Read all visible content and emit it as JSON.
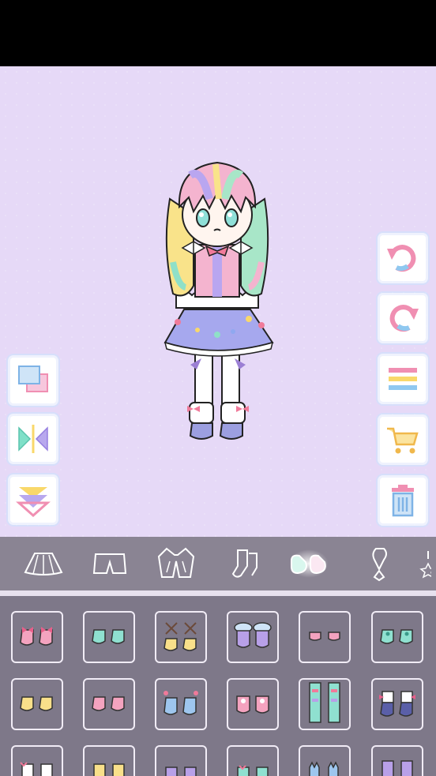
{
  "app": {
    "screen": "dress-up"
  },
  "colors": {
    "canvas_bg": "#e6d9f7",
    "tab_bar": "#8a8493",
    "grid_bg": "#7e7889",
    "item_border": "#f1ecf6"
  },
  "left_tools": [
    {
      "icon": "layers-icon"
    },
    {
      "icon": "flip-icon"
    },
    {
      "icon": "move-down-icon"
    }
  ],
  "right_tools": [
    {
      "icon": "undo-icon"
    },
    {
      "icon": "redo-icon"
    },
    {
      "icon": "menu-icon"
    },
    {
      "icon": "cart-icon"
    },
    {
      "icon": "trash-icon"
    }
  ],
  "tabs": [
    {
      "icon": "skirt-icon",
      "active": false
    },
    {
      "icon": "shorts-icon",
      "active": false
    },
    {
      "icon": "jacket-icon",
      "active": false
    },
    {
      "icon": "socks-icon",
      "active": false
    },
    {
      "icon": "shoes-icon",
      "active": true
    },
    {
      "icon": "accessory-icon",
      "active": false
    },
    {
      "icon": "more-icon",
      "active": false
    }
  ],
  "items": [
    {
      "icon": "pink-bow-shoes-icon"
    },
    {
      "icon": "mint-shoes-icon"
    },
    {
      "icon": "yellow-lace-shoes-icon"
    },
    {
      "icon": "purple-fluffy-shoes-icon"
    },
    {
      "icon": "pink-flats-icon"
    },
    {
      "icon": "mint-heart-shoes-icon"
    },
    {
      "icon": "yellow-shoes-icon"
    },
    {
      "icon": "pink-shoes-icon"
    },
    {
      "icon": "blue-heart-shoes-icon"
    },
    {
      "icon": "pink-bunny-shoes-icon"
    },
    {
      "icon": "mint-tall-boots-icon"
    },
    {
      "icon": "navy-bow-boots-icon"
    },
    {
      "icon": "white-ruffle-shoes-icon"
    },
    {
      "icon": "yellow-bow-shoes-icon"
    },
    {
      "icon": "purple-shoes-icon"
    },
    {
      "icon": "mint-sneakers-icon"
    },
    {
      "icon": "blue-cat-shoes-icon"
    },
    {
      "icon": "purple-boots-icon"
    }
  ]
}
